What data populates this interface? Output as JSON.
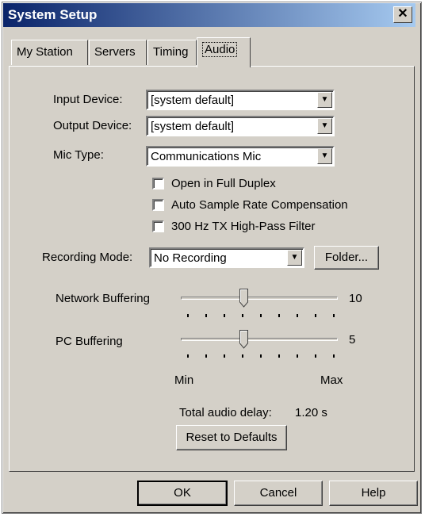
{
  "window": {
    "title": "System Setup",
    "close_glyph": "✕"
  },
  "tabs": [
    {
      "label": "My Station"
    },
    {
      "label": "Servers"
    },
    {
      "label": "Timing"
    },
    {
      "label": "Audio",
      "active": true
    }
  ],
  "audio": {
    "input_device": {
      "label": "Input Device:",
      "value": "[system default]"
    },
    "output_device": {
      "label": "Output Device:",
      "value": "[system default]"
    },
    "mic_type": {
      "label": "Mic Type:",
      "value": "Communications Mic"
    },
    "checkboxes": [
      {
        "label": "Open in Full Duplex",
        "checked": false
      },
      {
        "label": "Auto Sample Rate Compensation",
        "checked": false
      },
      {
        "label": "300 Hz TX High-Pass Filter",
        "checked": false
      }
    ],
    "recording_mode": {
      "label": "Recording Mode:",
      "value": "No Recording"
    },
    "folder_button": "Folder...",
    "network_buffering": {
      "label": "Network Buffering",
      "value": "10",
      "level": 0.4
    },
    "pc_buffering": {
      "label": "PC Buffering",
      "value": "5",
      "level": 0.4
    },
    "scale_min": "Min",
    "scale_max": "Max",
    "total_delay": {
      "label": "Total audio delay:",
      "value": "1.20 s"
    },
    "reset_button": "Reset to Defaults"
  },
  "buttons": {
    "ok": "OK",
    "cancel": "Cancel",
    "help": "Help"
  }
}
